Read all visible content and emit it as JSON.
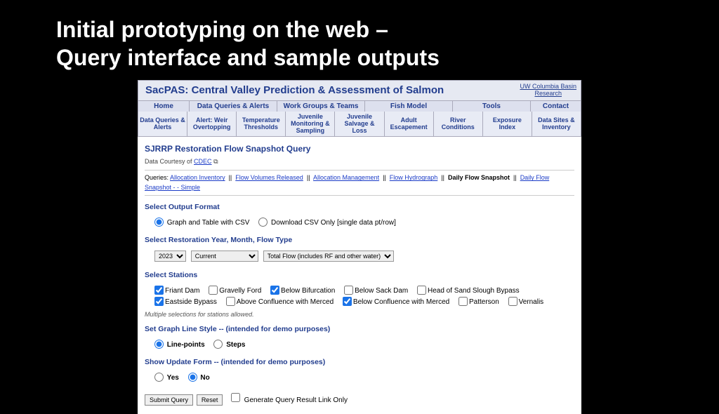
{
  "slide_title_l1": "Initial prototyping on the web –",
  "slide_title_l2": "Query interface and sample outputs",
  "header": {
    "title": "SacPAS: Central Valley Prediction & Assessment of Salmon",
    "right_l1": "UW Columbia Basin",
    "right_l2": "Research"
  },
  "topnav": [
    "Home",
    "Data Queries & Alerts",
    "Work Groups & Teams",
    "Fish Model",
    "Tools",
    "Contact"
  ],
  "subnav": [
    "Data Queries & Alerts",
    "Alert: Weir Overtopping",
    "Temperature Thresholds",
    "Juvenile Monitoring & Sampling",
    "Juvenile Salvage & Loss",
    "Adult Escapement",
    "River Conditions",
    "Exposure Index",
    "Data Sites & Inventory"
  ],
  "page_title": "SJRRP Restoration Flow Snapshot Query",
  "courtesy_prefix": "Data Courtesy of ",
  "courtesy_link": "CDEC",
  "queries": {
    "prefix": "Queries: ",
    "links": [
      "Allocation Inventory",
      "Flow Volumes Released",
      "Allocation Management",
      "Flow Hydrograph"
    ],
    "bold": "Daily Flow Snapshot",
    "tail": "Daily Flow Snapshot - - Simple"
  },
  "sections": {
    "output_format": {
      "title": "Select Output Format",
      "opt1": "Graph and Table with CSV",
      "opt2": "Download CSV Only [single data pt/row]"
    },
    "year": {
      "title": "Select Restoration Year, Month, Flow Type",
      "sel_year": "2023",
      "sel_month": "Current",
      "sel_flow": "Total Flow (includes RF and other water)"
    },
    "stations": {
      "title": "Select Stations",
      "row1": [
        {
          "label": "Friant Dam",
          "checked": true
        },
        {
          "label": "Gravelly Ford",
          "checked": false
        },
        {
          "label": "Below Bifurcation",
          "checked": true
        },
        {
          "label": "Below Sack Dam",
          "checked": false
        },
        {
          "label": "Head of Sand Slough Bypass",
          "checked": false
        }
      ],
      "row2": [
        {
          "label": "Eastside Bypass",
          "checked": true
        },
        {
          "label": "Above Confluence with Merced",
          "checked": false
        },
        {
          "label": "Below Confluence with Merced",
          "checked": true
        },
        {
          "label": "Patterson",
          "checked": false
        },
        {
          "label": "Vernalis",
          "checked": false
        }
      ],
      "note": "Multiple selections for stations allowed."
    },
    "linestyle": {
      "title": "Set Graph Line Style -- (intended for demo purposes)",
      "opt1": "Line-points",
      "opt2": "Steps"
    },
    "showform": {
      "title": "Show Update Form -- (intended for demo purposes)",
      "opt1": "Yes",
      "opt2": "No"
    }
  },
  "buttons": {
    "submit": "Submit Query",
    "reset": "Reset",
    "gen_link": "Generate Query Result Link Only"
  }
}
